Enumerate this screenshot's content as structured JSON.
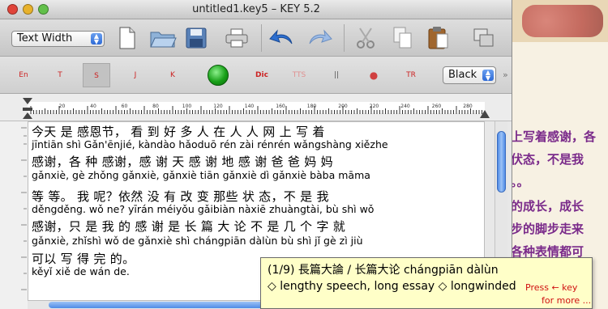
{
  "window": {
    "title": "untitled1.key5 – KEY 5.2"
  },
  "colors": {
    "close": "#e0443a",
    "minimize": "#e8b22c",
    "zoom": "#62c04a",
    "tool_red": "#cc2222",
    "tooltip_bg": "#ffffc8",
    "background_text": "#7a2a8a"
  },
  "toolbar1": {
    "mode_popup": "Text Width",
    "icons": [
      "new-document-icon",
      "open-folder-icon",
      "save-icon",
      "print-icon",
      "undo-icon",
      "redo-icon",
      "cut-icon",
      "copy-icon",
      "paste-icon",
      "window-icon"
    ]
  },
  "toolbar2": {
    "buttons": [
      {
        "label": "En",
        "name": "tool-en-button",
        "pressed": false
      },
      {
        "label": "T",
        "name": "tool-t-button",
        "pressed": false
      },
      {
        "label": "S",
        "name": "tool-s-button",
        "pressed": true
      },
      {
        "label": "J",
        "name": "tool-j-button",
        "pressed": false
      },
      {
        "label": "K",
        "name": "tool-k-button",
        "pressed": false
      },
      {
        "label": "Dic",
        "name": "tool-dic-button",
        "pressed": false
      },
      {
        "label": "TTS",
        "name": "tool-tts-button",
        "pressed": false
      },
      {
        "label": "||",
        "name": "tool-pause-button",
        "pressed": false
      },
      {
        "label": "●",
        "name": "tool-record-button",
        "pressed": false
      },
      {
        "label": "TR",
        "name": "tool-tr-button",
        "pressed": false
      }
    ],
    "color_popup": "Black"
  },
  "ruler": {
    "labels": [
      "20",
      "40",
      "60",
      "80",
      "100",
      "120",
      "140",
      "160",
      "180",
      "200",
      "220",
      "240",
      "260",
      "280"
    ]
  },
  "document": {
    "lines": [
      {
        "hanzi": "今天 是  感恩节，  看 到  好 多 人 在 人 人  网   上  写 着",
        "pinyin": "jīntiān shì Gǎn'ēnjié,   kàndào hǎoduō rén zài rénrén wǎngshàng xiězhe"
      },
      {
        "hanzi": " 感谢，各   种   感谢，感 谢 天  感 谢 地 感 谢 爸 爸 妈 妈",
        "pinyin": "gǎnxiè,   gè zhǒng gǎnxiè,   gǎnxiè tiān gǎnxiè dì gǎnxiè bàba māma"
      },
      {
        "hanzi": "  等  等。 我  呢？依然  没 有 改 变  那些   状   态，不 是  我",
        "pinyin": "děngděng.   wǒ ne?  yīrán méiyǒu gǎibiàn nàxiē zhuàngtài,   bù shì wǒ"
      },
      {
        "hanzi": " 感谢，只 是 我  的 感 谢 是   长    篇  大 论 不 是 几 个 字 就",
        "pinyin": "gǎnxiè,   zhǐshì wǒ de gǎnxiè shì chángpiān dàlùn bù shì jǐ gè zì jiù"
      },
      {
        "hanzi": "可以 写  得   完  的。",
        "pinyin": "kěyǐ   xiě de wán de."
      }
    ]
  },
  "tooltip": {
    "line1": "(1/9) 長篇大論 / 长篇大论  chángpiān dàlùn",
    "line2": "◇ lengthy speech, long essay ◇ longwinded",
    "press": "Press ← key",
    "more": "for more ..."
  },
  "background_page": {
    "lines": [
      "上写着感谢，各",
      "伏态，不是我",
      "。。",
      "的成长，成长",
      "步的脚步走来",
      "各种表情都可"
    ]
  }
}
